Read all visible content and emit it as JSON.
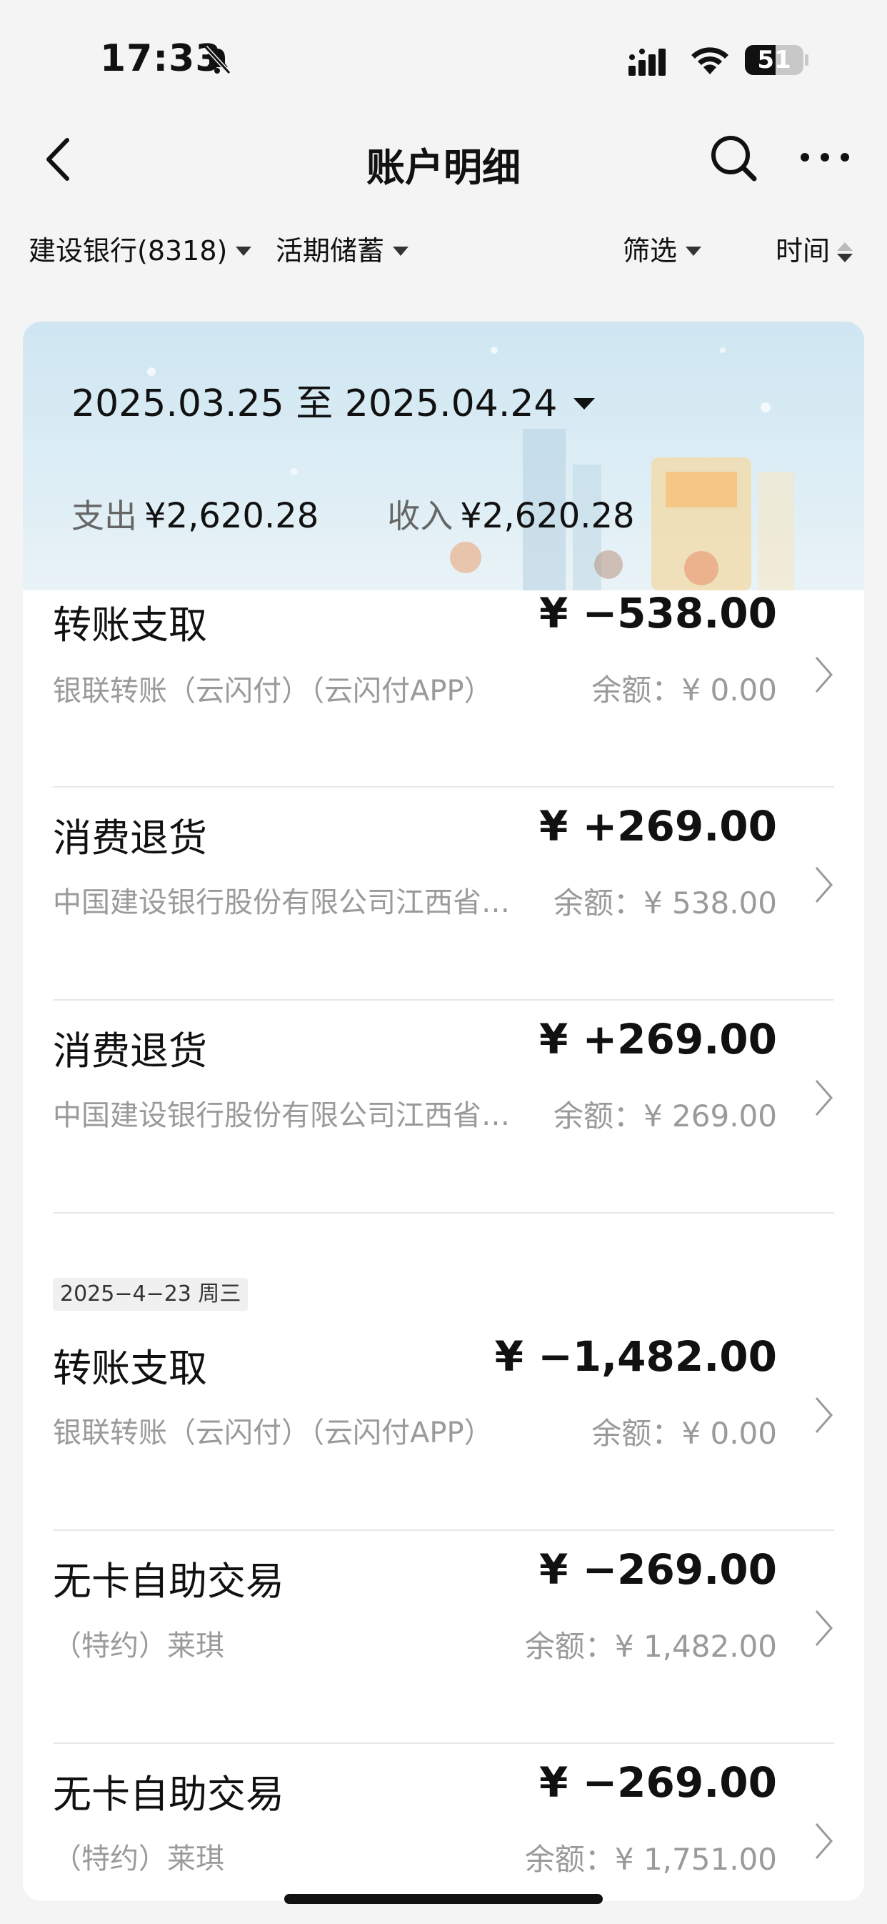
{
  "status_bar": {
    "time": "17:33",
    "battery": "51"
  },
  "header": {
    "title": "账户明细"
  },
  "filters": {
    "account": "建设银行(8318)",
    "account_type": "活期储蓄",
    "filter": "筛选",
    "sort": "时间"
  },
  "summary": {
    "date_range": "2025.03.25 至 2025.04.24",
    "expense_label": "支出",
    "expense": "¥2,620.28",
    "income_label": "收入",
    "income": "¥2,620.28"
  },
  "transactions_top": [
    {
      "title": "转账支取",
      "amount": "¥ −538.00",
      "desc": "银联转账（云闪付）（云闪付APP）",
      "balance": "余额：¥ 0.00"
    },
    {
      "title": "消费退货",
      "amount": "¥ +269.00",
      "desc": "中国建设银行股份有限公司江西省分…",
      "balance": "余额：¥ 538.00"
    },
    {
      "title": "消费退货",
      "amount": "¥ +269.00",
      "desc": "中国建设银行股份有限公司江西省分…",
      "balance": "余额：¥ 269.00"
    }
  ],
  "date_group": "2025−4−23 周三",
  "transactions_bottom": [
    {
      "title": "转账支取",
      "amount": "¥ −1,482.00",
      "desc": "银联转账（云闪付）（云闪付APP）",
      "balance": "余额：¥ 0.00"
    },
    {
      "title": "无卡自助交易",
      "amount": "¥ −269.00",
      "desc": "（特约）莱琪",
      "balance": "余额：¥ 1,482.00"
    },
    {
      "title": "无卡自助交易",
      "amount": "¥ −269.00",
      "desc": "（特约）莱琪",
      "balance": "余额：¥ 1,751.00"
    }
  ],
  "colors": {
    "background": "#f4f4f4",
    "banner": "#d6eaf4",
    "muted_text": "#9a9a9a"
  },
  "icons": [
    "bell-slash-icon",
    "signal-icon",
    "wifi-icon",
    "battery-icon",
    "back-arrow-icon",
    "search-icon",
    "more-icon",
    "chevron-right-icon"
  ]
}
